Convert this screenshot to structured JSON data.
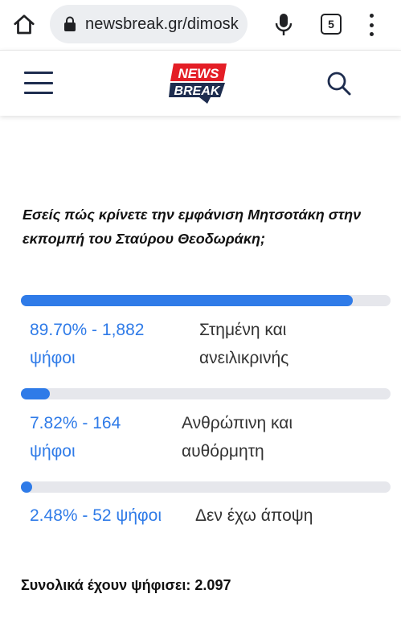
{
  "browser": {
    "url": "newsbreak.gr/dimosk",
    "tab_count": "5"
  },
  "site": {
    "logo_line1": "NEWS",
    "logo_line2": "BREAK",
    "colors": {
      "brand_red": "#e41e26",
      "brand_navy": "#1e2d4f",
      "accent_blue": "#2f7be8"
    }
  },
  "poll": {
    "question": "Εσείς πώς κρίνετε την εμφάνιση Μητσοτάκη στην εκπομπή του Σταύρου Θεοδωράκη;",
    "results": [
      {
        "value_text": "89.70% - 1,882 ψήφοι",
        "label": "Στημένη και ανειλικρινής",
        "percent": 89.7
      },
      {
        "value_text": "7.82% - 164 ψήφοι",
        "label": "Ανθρώπινη και αυθόρμητη",
        "percent": 7.82
      },
      {
        "value_text": "2.48% - 52 ψήφοι",
        "label": "Δεν έχω άποψη",
        "percent": 2.48
      }
    ],
    "total_label": "Συνολικά έχουν ψήφισει:",
    "total_value": "2.097"
  }
}
